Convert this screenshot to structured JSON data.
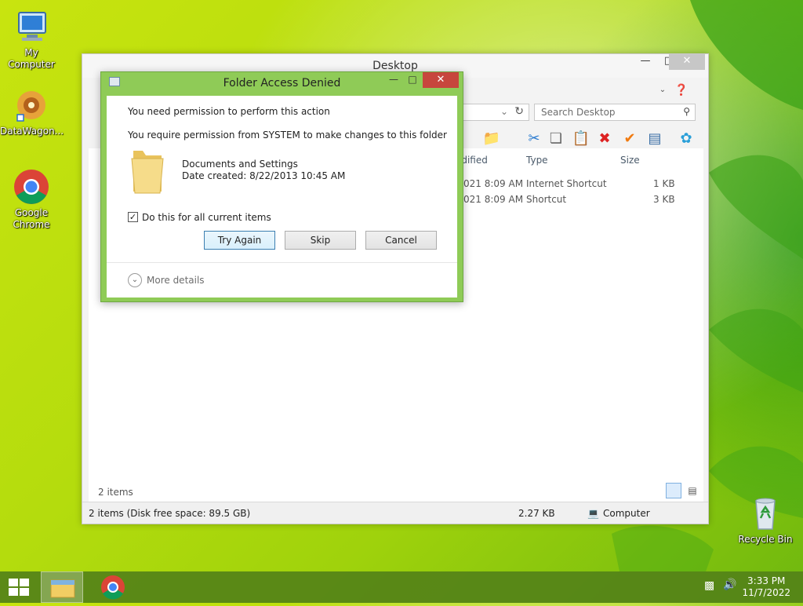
{
  "desktop": {
    "icons": [
      {
        "label": "My Computer"
      },
      {
        "label": "DataWagon..."
      },
      {
        "label": "Google Chrome"
      },
      {
        "label": "Recycle Bin"
      }
    ]
  },
  "explorer": {
    "title": "Desktop",
    "search_placeholder": "Search Desktop",
    "columns": {
      "modified": "odified",
      "type": "Type",
      "size": "Size"
    },
    "rows": [
      {
        "modified": "021 8:09 AM",
        "type": "Internet Shortcut",
        "size": "1 KB"
      },
      {
        "modified": "021 8:09 AM",
        "type": "Shortcut",
        "size": "3 KB"
      }
    ],
    "item_count": "2 items",
    "status": {
      "left": "2 items (Disk free space: 89.5 GB)",
      "size": "2.27 KB",
      "location": "Computer"
    }
  },
  "dialog": {
    "title": "Folder Access Denied",
    "heading": "You need permission to perform this action",
    "message": "You require permission from SYSTEM to make changes to this folder",
    "item_name": "Documents and Settings",
    "item_date": "Date created: 8/22/2013 10:45 AM",
    "checkbox_label": "Do this for all current items",
    "checkbox_checked": true,
    "buttons": {
      "try_again": "Try Again",
      "skip": "Skip",
      "cancel": "Cancel"
    },
    "more_details": "More details"
  },
  "taskbar": {
    "time": "3:33 PM",
    "date": "11/7/2022"
  },
  "colors": {
    "dialog_frame": "#8fcb57",
    "taskbar": "#548218",
    "close_red": "#c7463d"
  }
}
